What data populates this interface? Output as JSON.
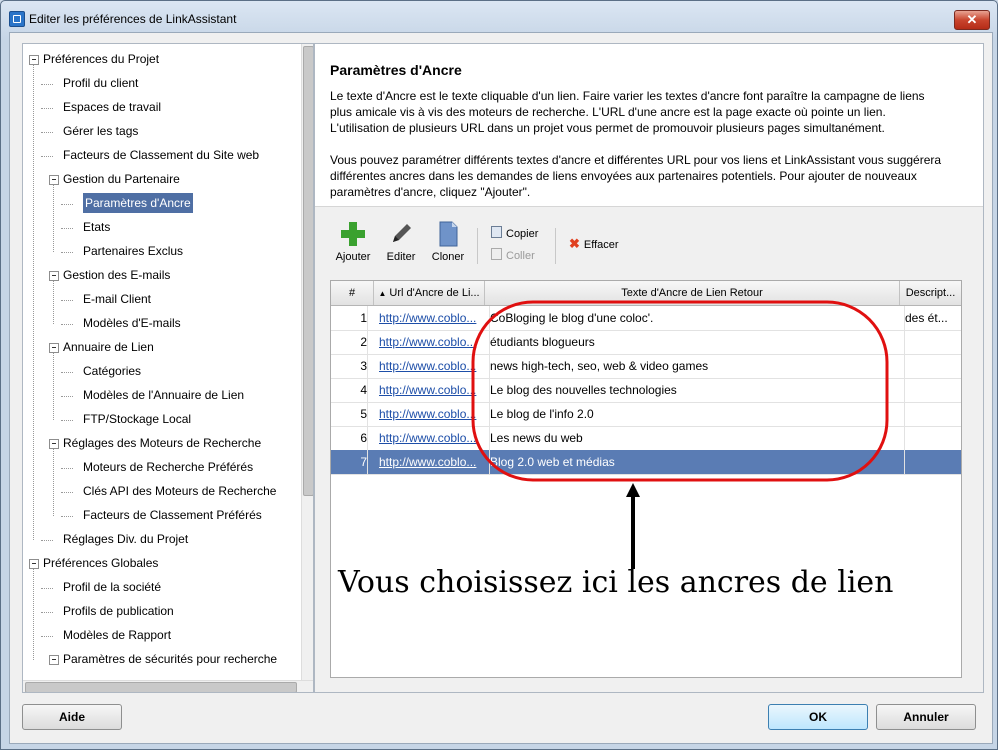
{
  "window": {
    "title": "Editer les préférences de LinkAssistant",
    "close_glyph": "✕"
  },
  "tree": [
    {
      "label": "Préférences du Projet",
      "level": 0,
      "expander": true
    },
    {
      "label": "Profil du client",
      "level": 1
    },
    {
      "label": "Espaces de travail",
      "level": 1
    },
    {
      "label": "Gérer les tags",
      "level": 1
    },
    {
      "label": "Facteurs de Classement du Site web",
      "level": 1
    },
    {
      "label": "Gestion du Partenaire",
      "level": 1,
      "expander": true
    },
    {
      "label": "Paramètres d'Ancre",
      "level": 2,
      "selected": true
    },
    {
      "label": "Etats",
      "level": 2
    },
    {
      "label": "Partenaires Exclus",
      "level": 2
    },
    {
      "label": "Gestion des E-mails",
      "level": 1,
      "expander": true
    },
    {
      "label": "E-mail Client",
      "level": 2
    },
    {
      "label": "Modèles d'E-mails",
      "level": 2
    },
    {
      "label": "Annuaire de Lien",
      "level": 1,
      "expander": true
    },
    {
      "label": "Catégories",
      "level": 2
    },
    {
      "label": "Modèles de l'Annuaire de Lien",
      "level": 2
    },
    {
      "label": "FTP/Stockage Local",
      "level": 2
    },
    {
      "label": "Réglages des Moteurs de Recherche",
      "level": 1,
      "expander": true
    },
    {
      "label": "Moteurs de Recherche Préférés",
      "level": 2
    },
    {
      "label": "Clés API des Moteurs de Recherche",
      "level": 2
    },
    {
      "label": "Facteurs de Classement Préférés",
      "level": 2
    },
    {
      "label": "Réglages Div. du Projet",
      "level": 1
    },
    {
      "label": "Préférences Globales",
      "level": 0,
      "expander": true
    },
    {
      "label": "Profil de la société",
      "level": 1
    },
    {
      "label": "Profils de publication",
      "level": 1
    },
    {
      "label": "Modèles de Rapport",
      "level": 1
    },
    {
      "label": "Paramètres de sécurités pour recherche",
      "level": 1,
      "expander": true
    }
  ],
  "panel": {
    "title": "Paramètres d'Ancre",
    "desc1": [
      "Le texte d'Ancre est le texte cliquable d'un lien. Faire varier les textes d'ancre font paraître la campagne de liens",
      "plus amicale vis à vis des moteurs de recherche. L'URL d'une ancre est la page exacte où pointe un lien.",
      "L'utilisation de plusieurs URL dans un projet vous permet de promouvoir plusieurs pages simultanément."
    ],
    "desc2": [
      "Vous pouvez paramétrer différents textes d'ancre et différentes URL pour vos liens et LinkAssistant vous suggérera",
      "différentes ancres dans les demandes de liens envoyées aux partenaires potentiels. Pour ajouter de nouveaux",
      "paramètres d'ancre, cliquez \"Ajouter\"."
    ]
  },
  "toolbar": {
    "add": "Ajouter",
    "edit": "Editer",
    "clone": "Cloner",
    "copy": "Copier",
    "paste": "Coller",
    "delete": "Effacer"
  },
  "table": {
    "columns": [
      "#",
      "Url d'Ancre de Li...",
      "Texte d'Ancre de Lien Retour",
      "Descript..."
    ],
    "sort_glyph": "▲",
    "rows": [
      {
        "num": "1",
        "url": "http://www.coblo...",
        "text": "CoBloging le blog d'une coloc'.",
        "desc": "des ét..."
      },
      {
        "num": "2",
        "url": "http://www.coblo...",
        "text": "étudiants blogueurs",
        "desc": ""
      },
      {
        "num": "3",
        "url": "http://www.coblo...",
        "text": "news high-tech, seo, web & video games",
        "desc": ""
      },
      {
        "num": "4",
        "url": "http://www.coblo...",
        "text": "Le blog des nouvelles technologies",
        "desc": ""
      },
      {
        "num": "5",
        "url": "http://www.coblo...",
        "text": "Le blog de l'info 2.0",
        "desc": ""
      },
      {
        "num": "6",
        "url": "http://www.coblo...",
        "text": "Les news du web",
        "desc": ""
      },
      {
        "num": "7",
        "url": "http://www.coblo...",
        "text": "Blog 2.0 web et médias",
        "desc": "",
        "selected": true
      }
    ]
  },
  "annotation": "Vous choisissez ici les ancres de lien",
  "buttons": {
    "help": "Aide",
    "ok": "OK",
    "cancel": "Annuler"
  },
  "colors": {
    "selection": "#5a7cb4",
    "highlight_circle": "#e01010"
  }
}
